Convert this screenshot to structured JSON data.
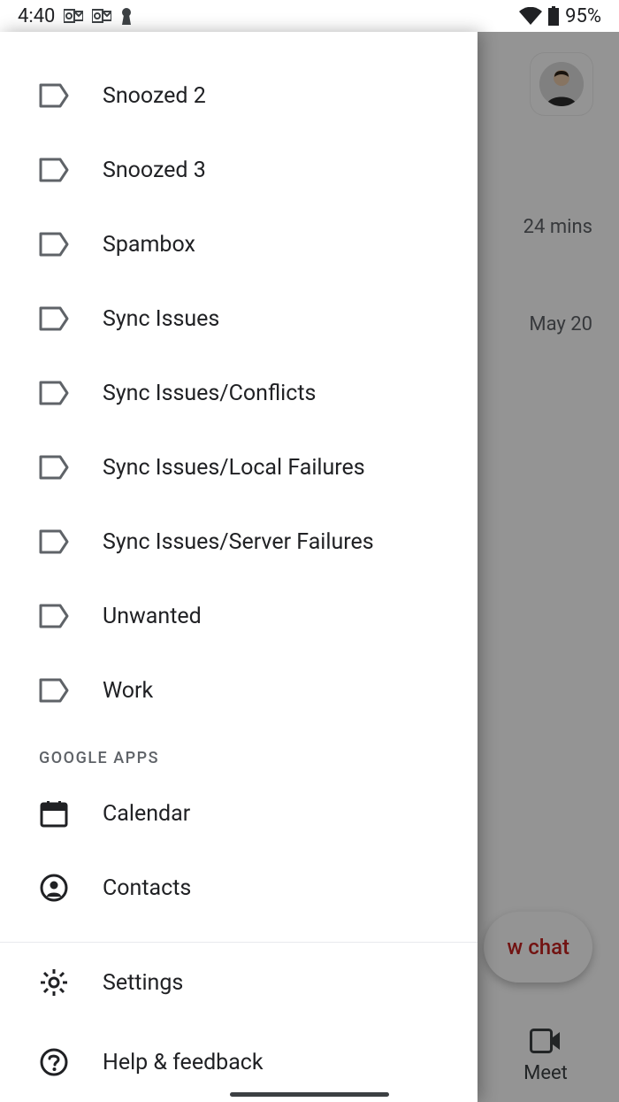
{
  "status": {
    "time": "4:40",
    "battery": "95%"
  },
  "behind": {
    "thread1_time": "24 mins",
    "thread2_time": "May 20",
    "fab_partial": "w chat",
    "meet_label": "Meet"
  },
  "drawer": {
    "labels": [
      {
        "label": "Snoozed 2"
      },
      {
        "label": "Snoozed 3"
      },
      {
        "label": "Spambox"
      },
      {
        "label": "Sync Issues"
      },
      {
        "label": "Sync Issues/Conflicts"
      },
      {
        "label": "Sync Issues/Local Failures"
      },
      {
        "label": "Sync Issues/Server Failures"
      },
      {
        "label": "Unwanted"
      },
      {
        "label": "Work"
      }
    ],
    "section_google_apps": "GOOGLE APPS",
    "apps": [
      {
        "label": "Calendar"
      },
      {
        "label": "Contacts"
      }
    ],
    "footer": [
      {
        "label": "Settings"
      },
      {
        "label": "Help & feedback"
      }
    ]
  }
}
